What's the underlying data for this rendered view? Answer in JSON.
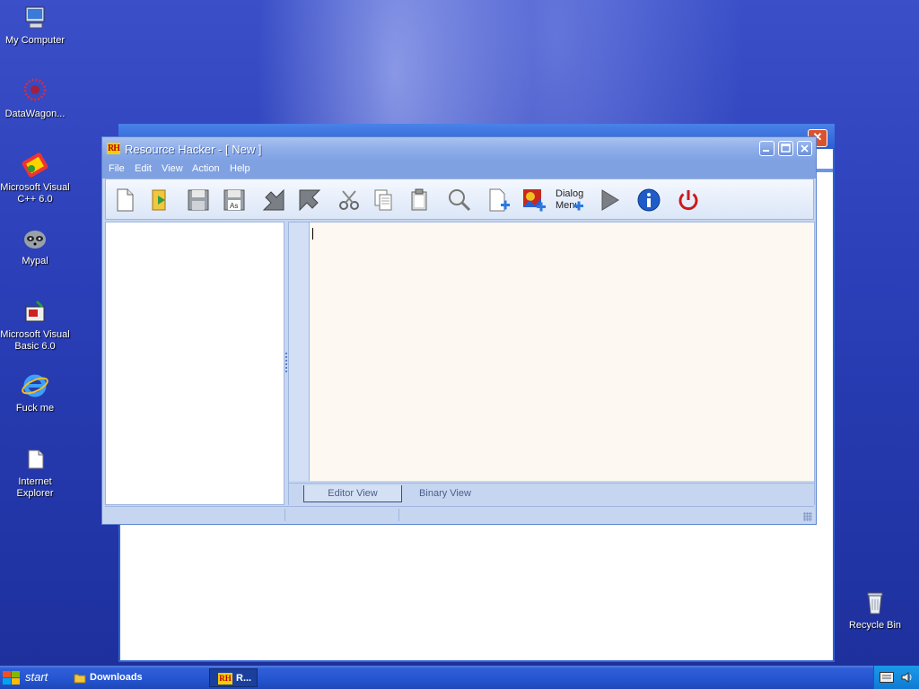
{
  "desktop": {
    "icons": [
      {
        "name": "my-computer",
        "label": "My Computer"
      },
      {
        "name": "datawagon",
        "label": "DataWagon..."
      },
      {
        "name": "visual-cpp",
        "label": "Microsoft Visual C++ 6.0"
      },
      {
        "name": "mypal",
        "label": "Mypal"
      },
      {
        "name": "visual-basic",
        "label": "Microsoft Visual Basic 6.0"
      },
      {
        "name": "internet-explorer-fake",
        "label": "Fuck me"
      },
      {
        "name": "internet-explorer-folder",
        "label": "Internet Explorer"
      },
      {
        "name": "recycle-bin",
        "label": "Recycle Bin"
      }
    ]
  },
  "window": {
    "title": "Resource Hacker - [ New ]",
    "logo": "RH",
    "menu": [
      "File",
      "Edit",
      "View",
      "Action",
      "Help"
    ],
    "toolbar": {
      "dialog_menu_label_1": "Dialog",
      "dialog_menu_label_2": "Menu"
    },
    "tabs": [
      "Editor View",
      "Binary View"
    ],
    "active_tab": "Editor View"
  },
  "background_window": {
    "close_glyph": "✕"
  },
  "taskbar": {
    "start_label": "start",
    "items": [
      {
        "label": "Downloads"
      },
      {
        "label": "R..."
      }
    ],
    "taskbar_logo": "RH"
  },
  "colors": {
    "desktop_blue": "#2b3fb8",
    "title_blue": "#8dadea",
    "editor_bg": "#fdf8f2"
  }
}
